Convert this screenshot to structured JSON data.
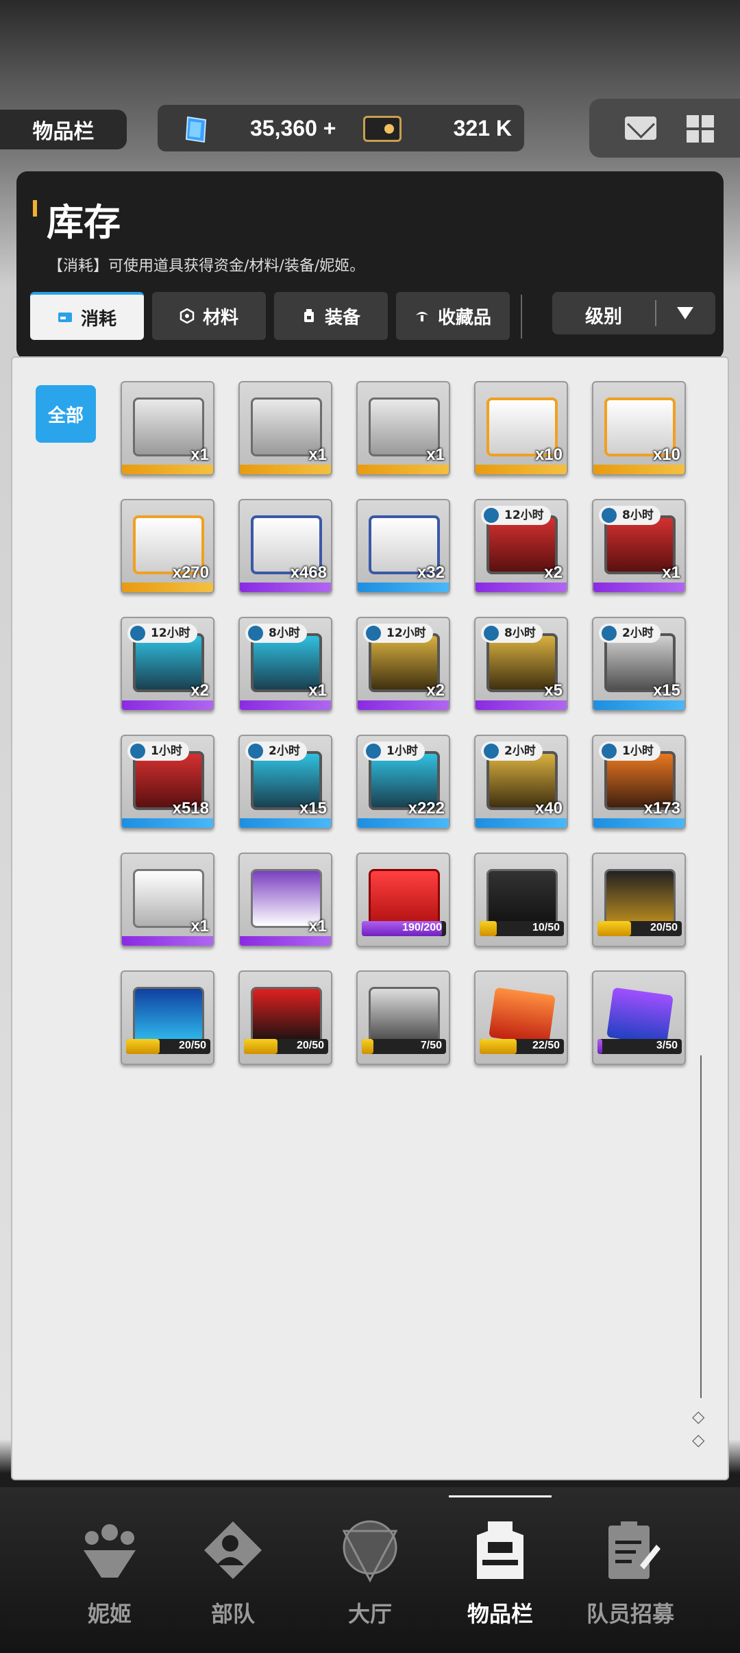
{
  "header": {
    "page_tag": "物品栏",
    "gems": "35,360",
    "gems_plus": "+",
    "coins": "321 K"
  },
  "inventory": {
    "title": "库存",
    "description": "【消耗】可使用道具获得资金/材料/装备/妮姬。",
    "tabs": [
      {
        "label": "消耗",
        "active": true
      },
      {
        "label": "材料",
        "active": false
      },
      {
        "label": "装备",
        "active": false
      },
      {
        "label": "收藏品",
        "active": false
      }
    ],
    "sort": {
      "label": "级别"
    },
    "filter_all": "全部"
  },
  "items": [
    {
      "qty": "x1",
      "timer": "",
      "progress": "",
      "rarity": "gold",
      "art": "box"
    },
    {
      "qty": "x1",
      "timer": "",
      "progress": "",
      "rarity": "gold",
      "art": "box"
    },
    {
      "qty": "x1",
      "timer": "",
      "progress": "",
      "rarity": "gold",
      "art": "box"
    },
    {
      "qty": "x10",
      "timer": "",
      "progress": "",
      "rarity": "gold",
      "art": "orange"
    },
    {
      "qty": "x10",
      "timer": "",
      "progress": "",
      "rarity": "gold",
      "art": "orange"
    },
    {
      "qty": "x270",
      "timer": "",
      "progress": "",
      "rarity": "gold",
      "art": "orange"
    },
    {
      "qty": "x468",
      "timer": "",
      "progress": "",
      "rarity": "purple",
      "art": "blue"
    },
    {
      "qty": "x32",
      "timer": "",
      "progress": "",
      "rarity": "blue",
      "art": "blue"
    },
    {
      "qty": "x2",
      "timer": "12小时",
      "progress": "",
      "rarity": "purple",
      "art": "case-red"
    },
    {
      "qty": "x1",
      "timer": "8小时",
      "progress": "",
      "rarity": "purple",
      "art": "case-red"
    },
    {
      "qty": "x2",
      "timer": "12小时",
      "progress": "",
      "rarity": "purple",
      "art": "case-cyan"
    },
    {
      "qty": "x1",
      "timer": "8小时",
      "progress": "",
      "rarity": "purple",
      "art": "case-cyan"
    },
    {
      "qty": "x2",
      "timer": "12小时",
      "progress": "",
      "rarity": "purple",
      "art": "case-gold"
    },
    {
      "qty": "x5",
      "timer": "8小时",
      "progress": "",
      "rarity": "purple",
      "art": "case-gold"
    },
    {
      "qty": "x15",
      "timer": "2小时",
      "progress": "",
      "rarity": "blue",
      "art": "case-silver"
    },
    {
      "qty": "x518",
      "timer": "1小时",
      "progress": "",
      "rarity": "blue",
      "art": "case-red"
    },
    {
      "qty": "x15",
      "timer": "2小时",
      "progress": "",
      "rarity": "blue",
      "art": "case-cyan"
    },
    {
      "qty": "x222",
      "timer": "1小时",
      "progress": "",
      "rarity": "blue",
      "art": "case-cyan"
    },
    {
      "qty": "x40",
      "timer": "2小时",
      "progress": "",
      "rarity": "blue",
      "art": "case-gold"
    },
    {
      "qty": "x173",
      "timer": "1小时",
      "progress": "",
      "rarity": "blue",
      "art": "case-orange"
    },
    {
      "qty": "x1",
      "timer": "",
      "progress": "",
      "rarity": "purple",
      "art": "cube"
    },
    {
      "qty": "x1",
      "timer": "",
      "progress": "",
      "rarity": "purple",
      "art": "cube2"
    },
    {
      "qty": "",
      "timer": "",
      "progress": "190/200",
      "fill": 0.95,
      "fill_color": "purple",
      "rarity": "none",
      "art": "lucky"
    },
    {
      "qty": "",
      "timer": "",
      "progress": "10/50",
      "fill": 0.2,
      "fill_color": "gold",
      "rarity": "none",
      "art": "card-dark"
    },
    {
      "qty": "",
      "timer": "",
      "progress": "20/50",
      "fill": 0.4,
      "fill_color": "gold",
      "rarity": "none",
      "art": "card-gold"
    },
    {
      "qty": "",
      "timer": "",
      "progress": "20/50",
      "fill": 0.4,
      "fill_color": "gold",
      "rarity": "none",
      "art": "card-blue"
    },
    {
      "qty": "",
      "timer": "",
      "progress": "20/50",
      "fill": 0.4,
      "fill_color": "gold",
      "rarity": "none",
      "art": "card-red"
    },
    {
      "qty": "",
      "timer": "",
      "progress": "7/50",
      "fill": 0.14,
      "fill_color": "gold",
      "rarity": "none",
      "art": "card-silver"
    },
    {
      "qty": "",
      "timer": "",
      "progress": "22/50",
      "fill": 0.44,
      "fill_color": "gold",
      "rarity": "none",
      "art": "gem-orange"
    },
    {
      "qty": "",
      "timer": "",
      "progress": "3/50",
      "fill": 0.06,
      "fill_color": "purple",
      "rarity": "none",
      "art": "gem-purple"
    }
  ],
  "bottom_nav": [
    {
      "label": "妮姬",
      "icon": "nikke-icon",
      "active": false
    },
    {
      "label": "部队",
      "icon": "squad-icon",
      "active": false
    },
    {
      "label": "大厅",
      "icon": "lobby-icon",
      "active": false
    },
    {
      "label": "物品栏",
      "icon": "inventory-icon",
      "active": true
    },
    {
      "label": "队员招募",
      "icon": "recruit-icon",
      "active": false
    }
  ],
  "colors": {
    "accent_blue": "#2aa5ec",
    "rarity_gold": "#f0a020",
    "rarity_purple": "#8a2be2",
    "rarity_blue": "#1e8ee0"
  }
}
